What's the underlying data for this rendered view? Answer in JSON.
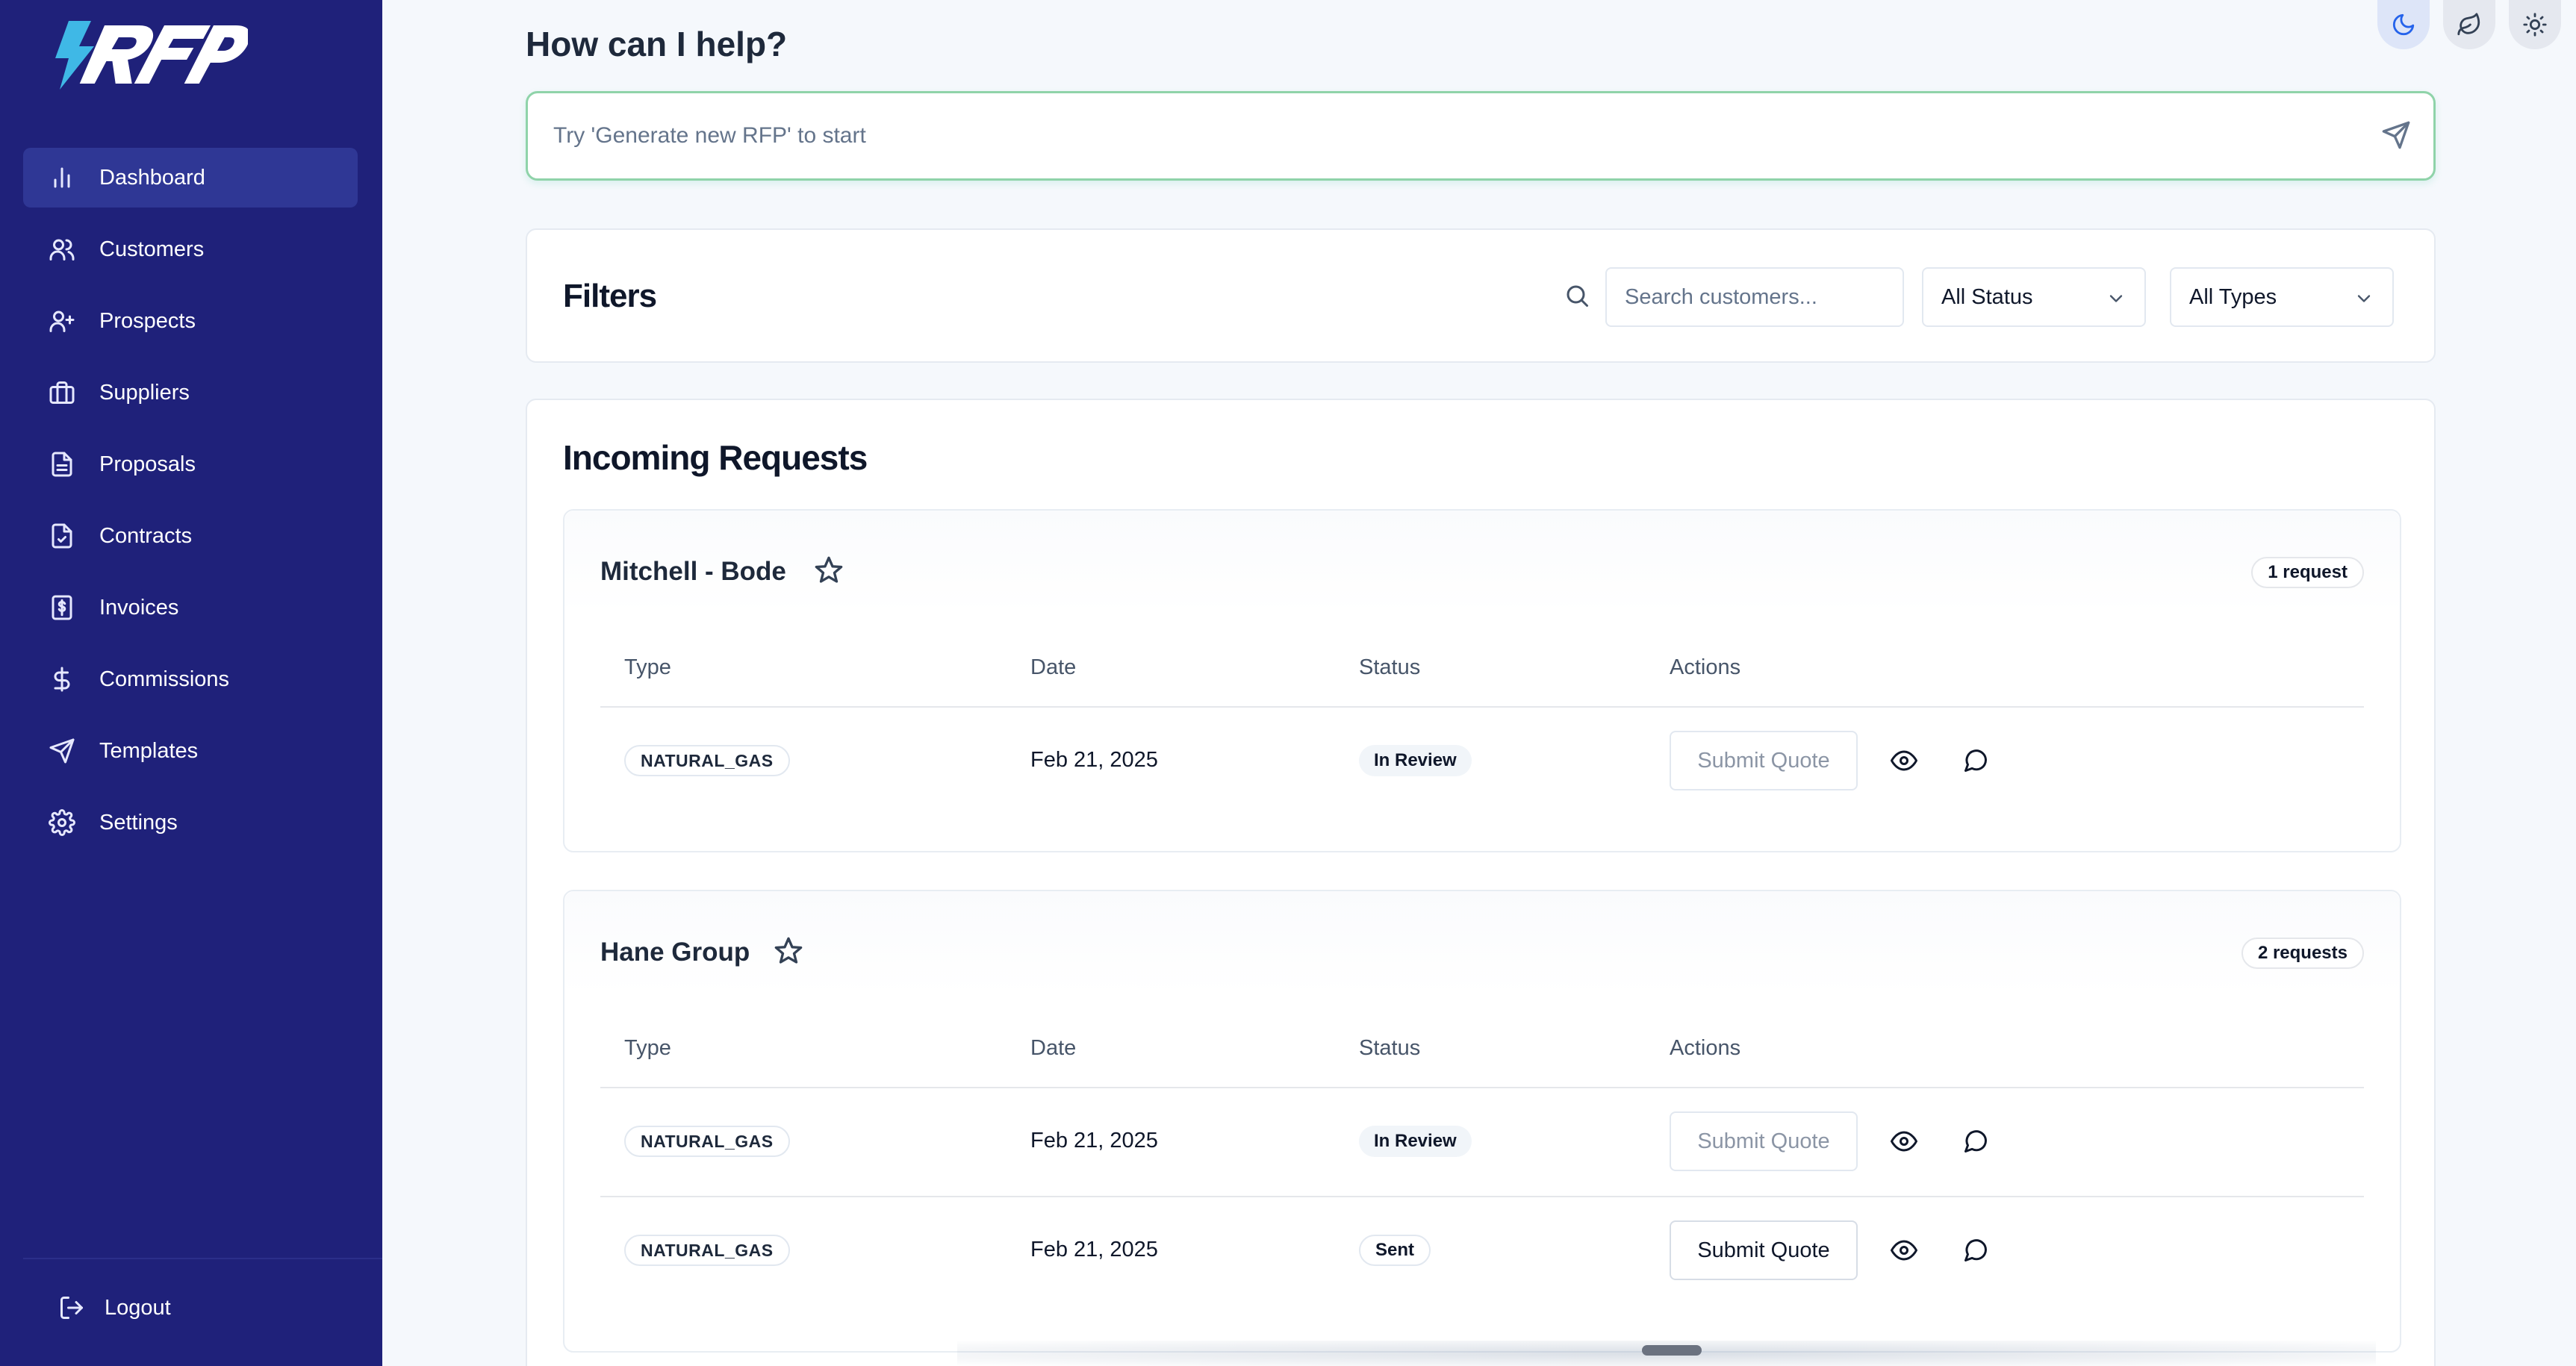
{
  "app": {
    "logo_text": "RFP"
  },
  "sidebar": {
    "items": [
      {
        "label": "Dashboard",
        "icon": "bar-chart-icon",
        "active": true
      },
      {
        "label": "Customers",
        "icon": "users-icon",
        "active": false
      },
      {
        "label": "Prospects",
        "icon": "user-plus-icon",
        "active": false
      },
      {
        "label": "Suppliers",
        "icon": "briefcase-icon",
        "active": false
      },
      {
        "label": "Proposals",
        "icon": "file-text-icon",
        "active": false
      },
      {
        "label": "Contracts",
        "icon": "file-check-icon",
        "active": false
      },
      {
        "label": "Invoices",
        "icon": "receipt-icon",
        "active": false
      },
      {
        "label": "Commissions",
        "icon": "dollar-icon",
        "active": false
      },
      {
        "label": "Templates",
        "icon": "send-icon",
        "active": false
      },
      {
        "label": "Settings",
        "icon": "gear-icon",
        "active": false
      }
    ],
    "logout_label": "Logout",
    "bg_color": "#1f217a",
    "active_color": "#2f3795"
  },
  "theme_toggles": [
    {
      "icon": "moon-icon",
      "selected": true
    },
    {
      "icon": "leaf-icon",
      "selected": false
    },
    {
      "icon": "sun-icon",
      "selected": false
    }
  ],
  "assistant": {
    "title": "How can I help?",
    "placeholder": "Try 'Generate new RFP' to start",
    "accent_color": "#8fd3a9"
  },
  "filters": {
    "title": "Filters",
    "search_placeholder": "Search customers...",
    "status_value": "All Status",
    "type_value": "All Types"
  },
  "requests": {
    "title": "Incoming Requests",
    "columns": [
      "Type",
      "Date",
      "Status",
      "Actions"
    ],
    "groups": [
      {
        "name": "Mitchell - Bode",
        "count_label": "1 request",
        "rows": [
          {
            "type": "NATURAL_GAS",
            "date": "Feb 21, 2025",
            "status": "In Review",
            "action": "Submit Quote",
            "action_enabled": false
          }
        ]
      },
      {
        "name": "Hane Group",
        "count_label": "2 requests",
        "rows": [
          {
            "type": "NATURAL_GAS",
            "date": "Feb 21, 2025",
            "status": "In Review",
            "action": "Submit Quote",
            "action_enabled": false
          },
          {
            "type": "NATURAL_GAS",
            "date": "Feb 21, 2025",
            "status": "Sent",
            "action": "Submit Quote",
            "action_enabled": true
          }
        ]
      }
    ]
  }
}
